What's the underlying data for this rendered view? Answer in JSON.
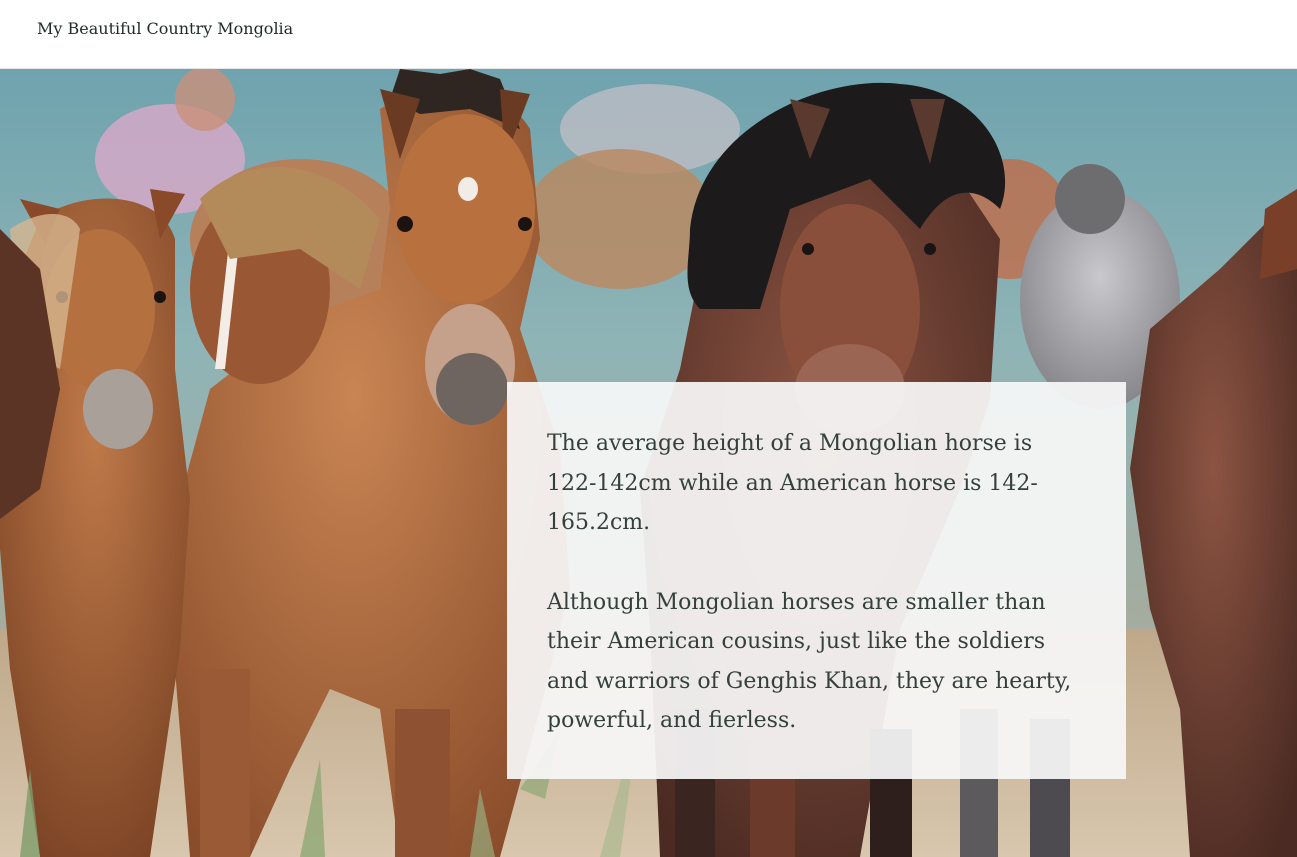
{
  "header": {
    "site_title": "My Beautiful Country Mongolia"
  },
  "hero": {
    "image_subject": "herd of horses running",
    "card": {
      "paragraphs": [
        "The average height of a Mongolian horse is 122-142cm while an American horse is 142-165.2cm.",
        "Although Mongolian horses are smaller than their American cousins, just like the soldiers and warriors of Genghis Khan, they are hearty, powerful, and fierless."
      ]
    }
  },
  "colors": {
    "header_bg": "#ffffff",
    "text": "#34403c",
    "card_bg": "#f8f8f8",
    "sky": "#5f9aa8",
    "chestnut": "#a8673f"
  }
}
